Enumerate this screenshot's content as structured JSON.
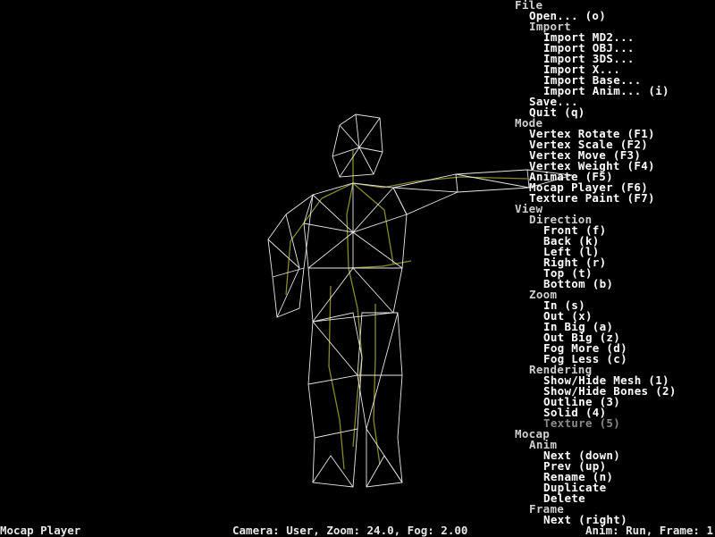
{
  "menu": {
    "file": "File",
    "open": "Open... (o)",
    "import": "Import",
    "import_md2": "Import MD2...",
    "import_obj": "Import OBJ...",
    "import_3ds": "Import 3DS...",
    "import_x": "Import X...",
    "import_base": "Import Base...",
    "import_anim": "Import Anim... (i)",
    "save": "Save...",
    "quit": "Quit (q)",
    "mode": "Mode",
    "vertex_rotate": "Vertex Rotate (F1)",
    "vertex_scale": "Vertex Scale (F2)",
    "vertex_move": "Vertex Move (F3)",
    "vertex_weight": "Vertex Weight (F4)",
    "animate": "Animate (F5)",
    "mocap_player": "Mocap Player (F6)",
    "texture_paint": "Texture Paint (F7)",
    "view": "View",
    "direction": "Direction",
    "front": "Front (f)",
    "back": "Back (k)",
    "left": "Left (l)",
    "right": "Right (r)",
    "top": "Top (t)",
    "bottom": "Bottom (b)",
    "zoom": "Zoom",
    "zoom_in": "In (s)",
    "zoom_out": "Out (x)",
    "in_big": "In Big (a)",
    "out_big": "Out Big (z)",
    "fog_more": "Fog More (d)",
    "fog_less": "Fog Less (c)",
    "rendering": "Rendering",
    "show_hide_mesh": "Show/Hide Mesh (1)",
    "show_hide_bones": "Show/Hide Bones (2)",
    "outline": "Outline (3)",
    "solid": "Solid (4)",
    "texture": "Texture (5)",
    "mocap": "Mocap",
    "anim": "Anim",
    "next": "Next (down)",
    "prev": "Prev (up)",
    "rename": "Rename (n)",
    "duplicate": "Duplicate",
    "delete": "Delete",
    "frame": "Frame",
    "next_frame": "Next (right)"
  },
  "status": {
    "mode": "Mocap Player",
    "camera": "Camera: User, Zoom: 24.0, Fog: 2.00",
    "anim": "Anim: Run, Frame: 1"
  },
  "colors": {
    "background": "#000000",
    "mesh": "#e8e8e8",
    "bones": "#8a8a2a",
    "menu_text": "#ffffff",
    "menu_disabled": "#8a8a8a"
  }
}
